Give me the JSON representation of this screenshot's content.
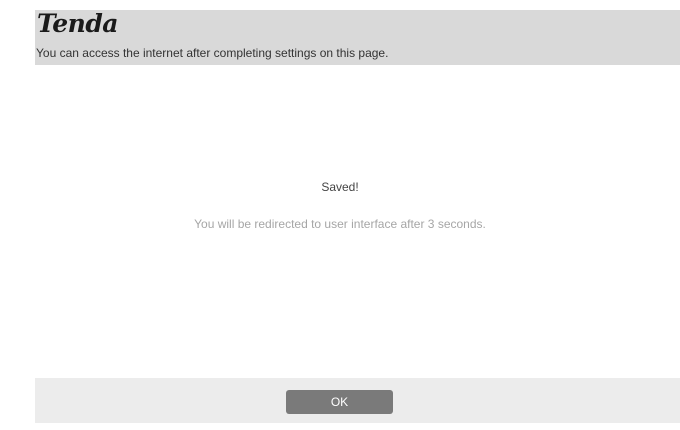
{
  "header": {
    "logo_text": "Tenda",
    "subtitle": "You can access the internet after completing settings on this page."
  },
  "message": {
    "title": "Saved!",
    "body": "You will be redirected to user interface after 3 seconds."
  },
  "footer": {
    "ok_label": "OK"
  },
  "colors": {
    "header_bg": "#d9d9d9",
    "content_bg": "#ffffff",
    "footer_bg": "#ececec",
    "button_bg": "#7a7a7a"
  }
}
